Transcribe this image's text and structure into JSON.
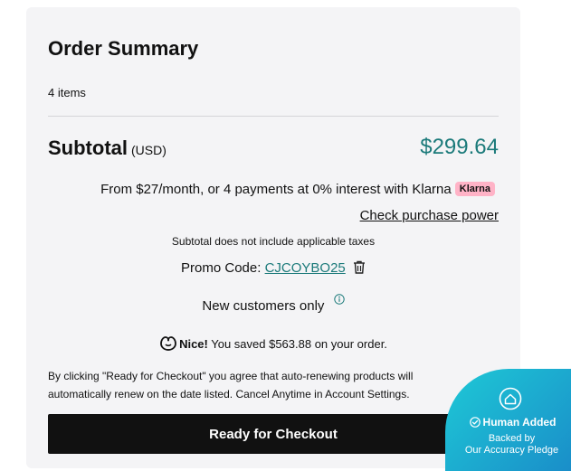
{
  "summary": {
    "title": "Order Summary",
    "items_count": "4 items",
    "subtotal_label": "Subtotal",
    "subtotal_currency": "(USD)",
    "subtotal_value": "$299.64",
    "klarna_text": "From $27/month, or 4 payments at 0% interest with Klarna",
    "klarna_badge": "Klarna",
    "purchase_power_link": "Check purchase power",
    "tax_note": "Subtotal does not include applicable taxes",
    "promo_label": "Promo Code:",
    "promo_code": "CJCOYBO25",
    "new_customers": "New customers only",
    "savings_nice": "Nice!",
    "savings_text": "You saved $563.88 on your order.",
    "terms": "By clicking \"Ready for Checkout\" you agree that auto-renewing products will automatically renew on the date listed. Cancel Anytime in Account Settings.",
    "checkout_button": "Ready for Checkout"
  },
  "pledge_badge": {
    "title": "Human Added",
    "line1": "Backed by",
    "line2": "Our Accuracy Pledge"
  },
  "colors": {
    "accent_teal": "#1b7a7a",
    "klarna_pink": "#ffb3c7",
    "button_dark": "#111111",
    "card_bg": "#f4f4f6"
  },
  "icons": [
    "trash-icon",
    "info-icon",
    "godaddy-logo-icon",
    "pledge-logo-icon",
    "check-icon"
  ]
}
